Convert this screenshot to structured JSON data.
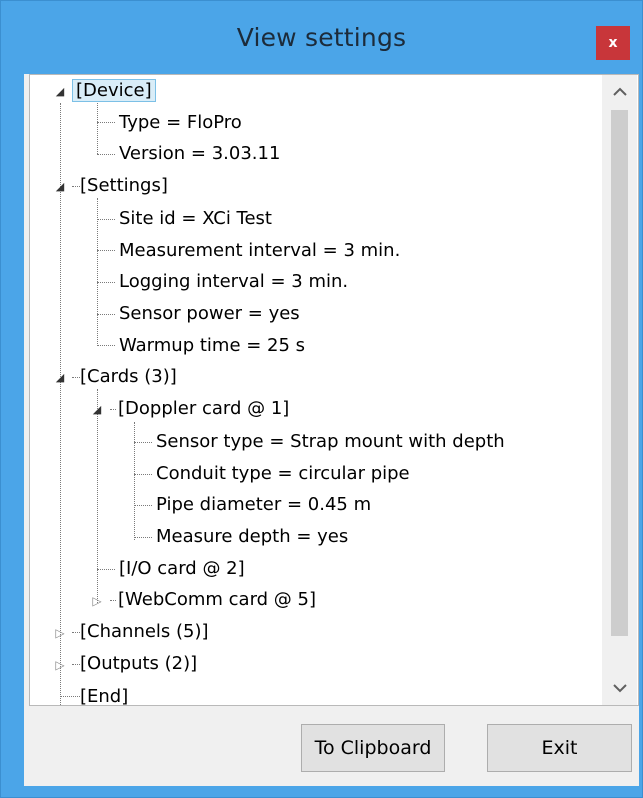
{
  "window": {
    "title": "View settings",
    "close_label": "x"
  },
  "tree": {
    "device": {
      "label": "[Device]",
      "type": "Type = FloPro",
      "version": "Version = 3.03.11"
    },
    "settings": {
      "label": "[Settings]",
      "site_id": "Site id = XCi Test",
      "measurement_interval": "Measurement interval = 3 min.",
      "logging_interval": "Logging interval = 3 min.",
      "sensor_power": "Sensor power = yes",
      "warmup_time": "Warmup time = 25 s"
    },
    "cards": {
      "label": "[Cards (3)]",
      "doppler": {
        "label": "[Doppler card @ 1]",
        "sensor_type": "Sensor type = Strap mount with depth",
        "conduit_type": "Conduit type = circular pipe",
        "pipe_diameter": "Pipe diameter = 0.45 m",
        "measure_depth": "Measure depth = yes"
      },
      "io": "[I/O card @ 2]",
      "webcomm": "[WebComm card @ 5]"
    },
    "channels": "[Channels (5)]",
    "outputs": "[Outputs (2)]",
    "end": "[End]"
  },
  "scrollbar": {
    "up_icon": "chevron-up",
    "down_icon": "chevron-down"
  },
  "buttons": {
    "clipboard": "To Clipboard",
    "exit": "Exit"
  }
}
